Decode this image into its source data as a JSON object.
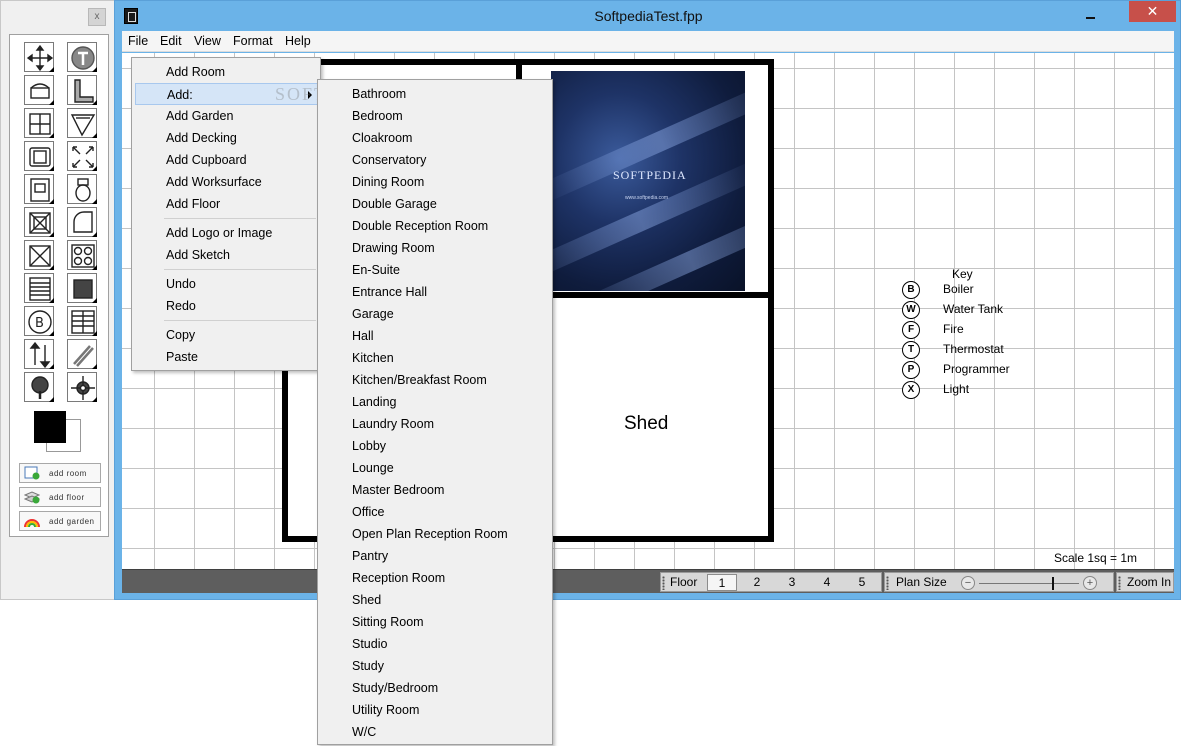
{
  "window": {
    "title": "SoftpediaTest.fpp",
    "close_glyph": "✕"
  },
  "toolbox": {
    "close_glyph": "x",
    "tools": [
      {
        "icon": "move-arrows-icon"
      },
      {
        "icon": "text-tool-icon"
      },
      {
        "icon": "door-icon"
      },
      {
        "icon": "wall-corner-icon"
      },
      {
        "icon": "window-icon"
      },
      {
        "icon": "angled-wall-icon"
      },
      {
        "icon": "sofa-icon"
      },
      {
        "icon": "resize-expand-icon"
      },
      {
        "icon": "cooker-icon"
      },
      {
        "icon": "toilet-icon"
      },
      {
        "icon": "hob-icon"
      },
      {
        "icon": "round-corner-icon"
      },
      {
        "icon": "cross-box-icon"
      },
      {
        "icon": "burner-hob-icon"
      },
      {
        "icon": "radiator-icon"
      },
      {
        "icon": "filled-square-icon"
      },
      {
        "icon": "boiler-symbol-icon"
      },
      {
        "icon": "stairs-icon"
      },
      {
        "icon": "arrows-up-down-icon"
      },
      {
        "icon": "diagonal-lines-icon"
      },
      {
        "icon": "tree-icon"
      },
      {
        "icon": "compass-icon"
      }
    ],
    "foreground_color": "#000000",
    "background_color": "#ffffff",
    "shortcuts": [
      {
        "label": "add room",
        "icon": "add-room-icon"
      },
      {
        "label": "add floor",
        "icon": "add-floor-icon"
      },
      {
        "label": "add garden",
        "icon": "rainbow-garden-icon"
      }
    ]
  },
  "menubar": {
    "items": [
      "File",
      "Edit",
      "View",
      "Format",
      "Help"
    ]
  },
  "canvas": {
    "image_caption": "SOFTPEDIA",
    "image_url": "www.softpedia.com",
    "shed_label": "Shed",
    "key": {
      "title": "Key",
      "items": [
        {
          "symbol": "B",
          "label": "Boiler"
        },
        {
          "symbol": "W",
          "label": "Water Tank"
        },
        {
          "symbol": "F",
          "label": "Fire"
        },
        {
          "symbol": "T",
          "label": "Thermostat"
        },
        {
          "symbol": "P",
          "label": "Programmer"
        },
        {
          "symbol": "X",
          "label": "Light"
        }
      ]
    },
    "scale_label": "Scale 1sq = 1m"
  },
  "statusbar": {
    "floor_label": "Floor",
    "floor_tabs": [
      "1",
      "2",
      "3",
      "4",
      "5"
    ],
    "selected_floor": "1",
    "plan_size_label": "Plan Size",
    "zoom_label": "Zoom In",
    "plan_size_level": 0.73
  },
  "context_menu": {
    "items": [
      {
        "label": "Add Room"
      },
      {
        "label": "Add:",
        "highlighted": true,
        "submenu": true
      },
      {
        "label": "Add Garden"
      },
      {
        "label": "Add Decking"
      },
      {
        "label": "Add Cupboard"
      },
      {
        "label": "Add Worksurface"
      },
      {
        "label": "Add Floor"
      },
      {
        "label": "Add Logo or Image"
      },
      {
        "label": "Add Sketch"
      },
      {
        "label": "Undo"
      },
      {
        "label": "Redo"
      },
      {
        "label": "Copy"
      },
      {
        "label": "Paste"
      }
    ]
  },
  "submenu": {
    "items": [
      "Bathroom",
      "Bedroom",
      "Cloakroom",
      "Conservatory",
      "Dining Room",
      "Double Garage",
      "Double Reception Room",
      "Drawing Room",
      "En-Suite",
      "Entrance Hall",
      "Garage",
      "Hall",
      "Kitchen",
      "Kitchen/Breakfast Room",
      "Landing",
      "Laundry Room",
      "Lobby",
      "Lounge",
      "Master Bedroom",
      "Office",
      "Open Plan Reception Room",
      "Pantry",
      "Reception Room",
      "Shed",
      "Sitting Room",
      "Studio",
      "Study",
      "Study/Bedroom",
      "Utility Room",
      "W/C"
    ]
  },
  "watermark": "SOFTPEDIA"
}
